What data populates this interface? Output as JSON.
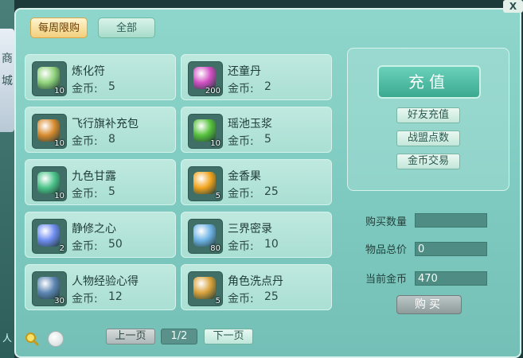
{
  "window": {
    "close_label": "X"
  },
  "side_tab": {
    "chars": [
      "商",
      "城"
    ]
  },
  "bottom_left_text": "人",
  "tabs": [
    {
      "label": "每周限购",
      "active": true
    },
    {
      "label": "全部",
      "active": false
    }
  ],
  "items": [
    {
      "name": "炼化符",
      "price_label": "金币:",
      "price": "5",
      "count": "10",
      "icon": "scroll-icon",
      "color": "#8fd37a"
    },
    {
      "name": "还童丹",
      "price_label": "金币:",
      "price": "2",
      "count": "200",
      "icon": "pill-icon",
      "color": "#d24fc4"
    },
    {
      "name": "飞行旗补充包",
      "price_label": "金币:",
      "price": "8",
      "count": "10",
      "icon": "flag-pack-icon",
      "color": "#d88a2e"
    },
    {
      "name": "瑶池玉浆",
      "price_label": "金币:",
      "price": "5",
      "count": "10",
      "icon": "jar-icon",
      "color": "#57c23c"
    },
    {
      "name": "九色甘露",
      "price_label": "金币:",
      "price": "5",
      "count": "10",
      "icon": "leaf-icon",
      "color": "#4cc48a"
    },
    {
      "name": "金香果",
      "price_label": "金币:",
      "price": "25",
      "count": "5",
      "icon": "fruit-icon",
      "color": "#f2a51f"
    },
    {
      "name": "静修之心",
      "price_label": "金币:",
      "price": "50",
      "count": "2",
      "icon": "heart-icon",
      "color": "#6f8df0"
    },
    {
      "name": "三界密录",
      "price_label": "金币:",
      "price": "10",
      "count": "80",
      "icon": "tome-icon",
      "color": "#6fb4e6"
    },
    {
      "name": "人物经验心得",
      "price_label": "金币:",
      "price": "12",
      "count": "30",
      "icon": "book-icon",
      "color": "#5d86b4"
    },
    {
      "name": "角色洗点丹",
      "price_label": "金币:",
      "price": "25",
      "count": "5",
      "icon": "gourd-icon",
      "color": "#d9a23b"
    }
  ],
  "right_panel": {
    "recharge_label": "充值",
    "buttons": [
      "好友充值",
      "战盟点数",
      "金币交易"
    ],
    "form": [
      {
        "label": "购买数量",
        "value": ""
      },
      {
        "label": "物品总价",
        "value": "0"
      },
      {
        "label": "当前金币",
        "value": "470"
      }
    ],
    "buy_label": "购买"
  },
  "pagination": {
    "prev_label": "上一页",
    "page": "1/2",
    "next_label": "下一页"
  }
}
